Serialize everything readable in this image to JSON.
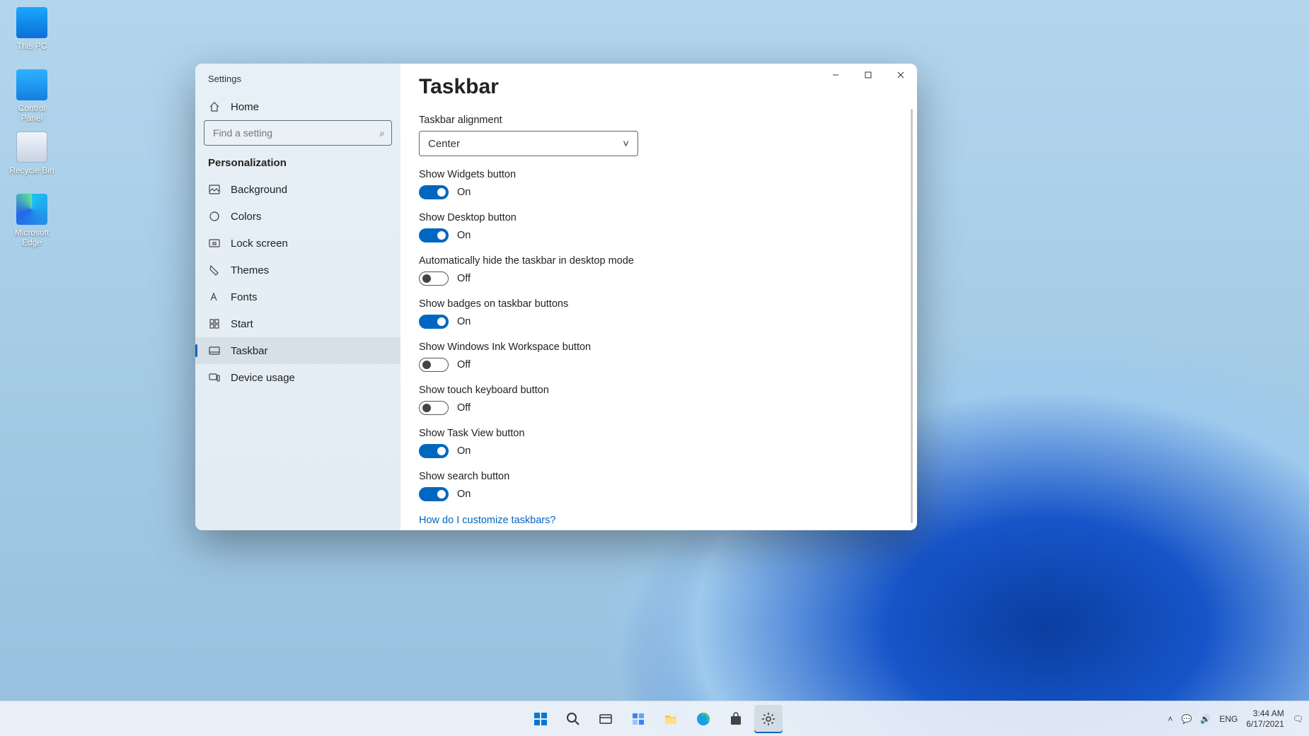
{
  "desktop_icons": [
    {
      "name": "this-pc",
      "label": "This PC"
    },
    {
      "name": "control-panel",
      "label": "Control Panel"
    },
    {
      "name": "recycle-bin",
      "label": "Recycle Bin"
    },
    {
      "name": "edge",
      "label": "Microsoft Edge"
    }
  ],
  "window": {
    "app_title": "Settings",
    "titlebar": {
      "minimize": "—",
      "maximize": "▢",
      "close": "✕"
    },
    "sidebar": {
      "home": "Home",
      "search_placeholder": "Find a setting",
      "category": "Personalization",
      "items": [
        {
          "icon": "background-icon",
          "label": "Background"
        },
        {
          "icon": "colors-icon",
          "label": "Colors"
        },
        {
          "icon": "lock-screen-icon",
          "label": "Lock screen"
        },
        {
          "icon": "themes-icon",
          "label": "Themes"
        },
        {
          "icon": "fonts-icon",
          "label": "Fonts"
        },
        {
          "icon": "start-icon",
          "label": "Start"
        },
        {
          "icon": "taskbar-icon",
          "label": "Taskbar",
          "active": true
        },
        {
          "icon": "device-usage-icon",
          "label": "Device usage"
        }
      ]
    },
    "page": {
      "title": "Taskbar",
      "alignment_label": "Taskbar alignment",
      "alignment_value": "Center",
      "toggles": [
        {
          "label": "Show Widgets button",
          "state": "On"
        },
        {
          "label": "Show Desktop button",
          "state": "On"
        },
        {
          "label": "Automatically hide the taskbar in desktop mode",
          "state": "Off"
        },
        {
          "label": "Show badges on taskbar buttons",
          "state": "On"
        },
        {
          "label": "Show Windows Ink Workspace button",
          "state": "Off"
        },
        {
          "label": "Show touch keyboard button",
          "state": "Off"
        },
        {
          "label": "Show Task View button",
          "state": "On"
        },
        {
          "label": "Show search button",
          "state": "On"
        }
      ],
      "help_link": "How do I customize taskbars?"
    }
  },
  "taskbar": {
    "apps": [
      {
        "name": "start",
        "glyph": "⊞"
      },
      {
        "name": "search",
        "glyph": "⌕"
      },
      {
        "name": "task-view",
        "glyph": "▥"
      },
      {
        "name": "widgets",
        "glyph": "◫"
      },
      {
        "name": "file-explorer",
        "glyph": "📁"
      },
      {
        "name": "edge",
        "glyph": "◉"
      },
      {
        "name": "store",
        "glyph": "🛍"
      },
      {
        "name": "settings",
        "glyph": "⚙",
        "active": true
      }
    ],
    "tray": {
      "chevron": "˄",
      "chat": "💬",
      "volume": "🔊",
      "lang": "ENG",
      "time": "3:44 AM",
      "date": "6/17/2021",
      "notifications": "🗨"
    }
  }
}
